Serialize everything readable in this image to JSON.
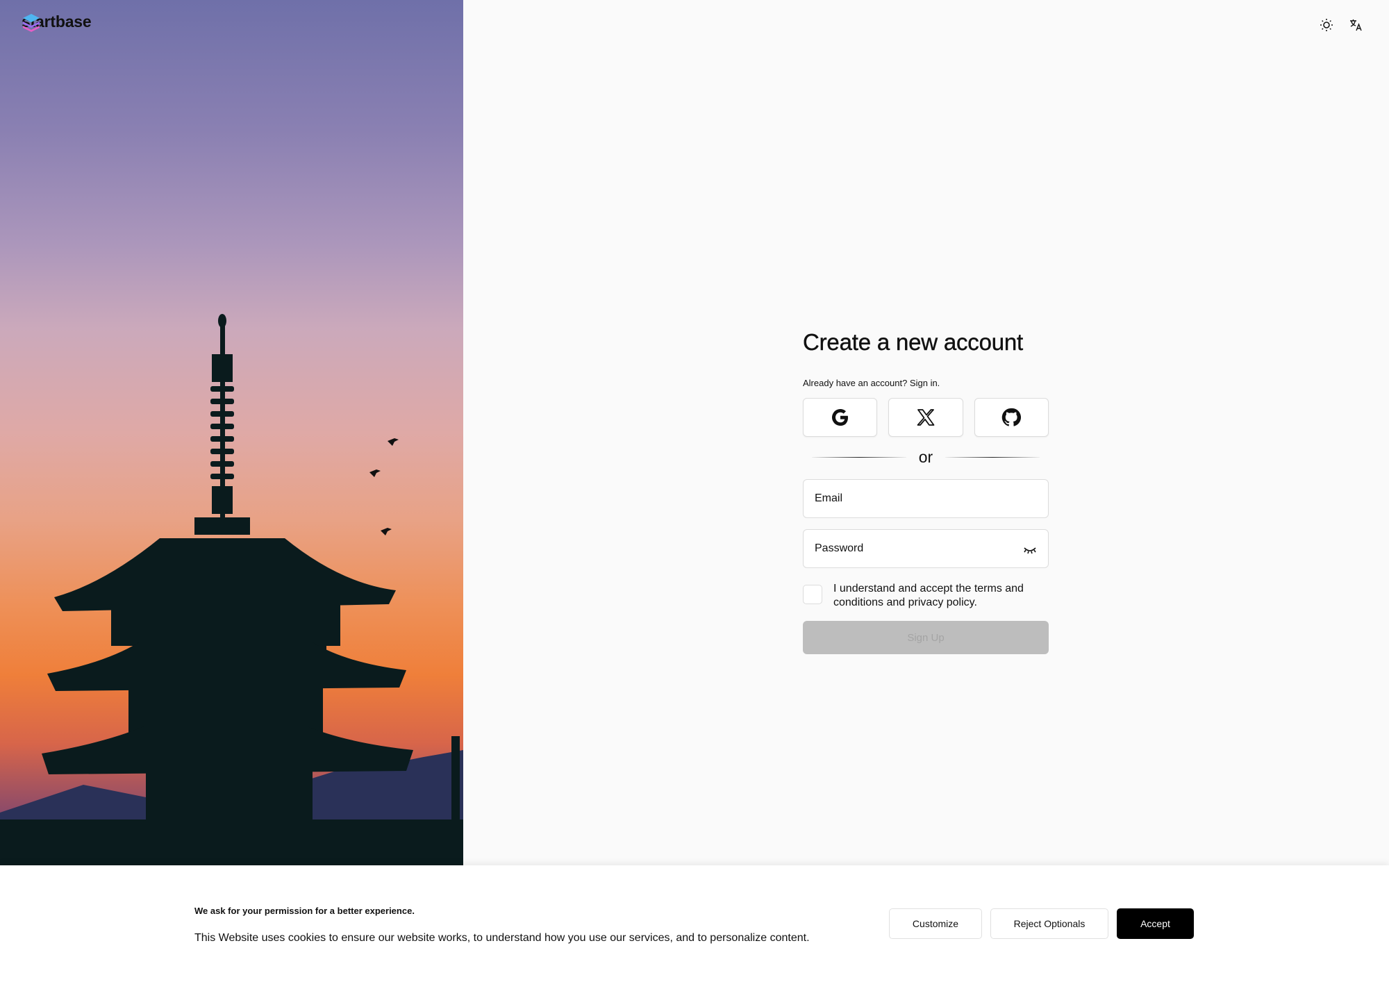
{
  "brand": {
    "name": "startbase"
  },
  "top_icons": {
    "theme": "sun-icon",
    "language": "translate-icon"
  },
  "form": {
    "title": "Create a new account",
    "signin_prompt": "Already have an account? Sign in.",
    "social": [
      "google-icon",
      "x-icon",
      "github-icon"
    ],
    "divider_text": "or",
    "email_placeholder": "Email",
    "password_placeholder": "Password",
    "terms_text": "I understand and accept the terms and conditions and privacy policy.",
    "submit_label": "Sign Up"
  },
  "cookie": {
    "title": "We ask for your permission for a better experience.",
    "body": "This Website uses cookies to ensure our website works, to understand how you use our services, and to personalize content.",
    "customize_label": "Customize",
    "reject_label": "Reject Optionals",
    "accept_label": "Accept"
  },
  "colors": {
    "accept_bg": "#000000",
    "submit_disabled_bg": "#bdbdbd"
  }
}
